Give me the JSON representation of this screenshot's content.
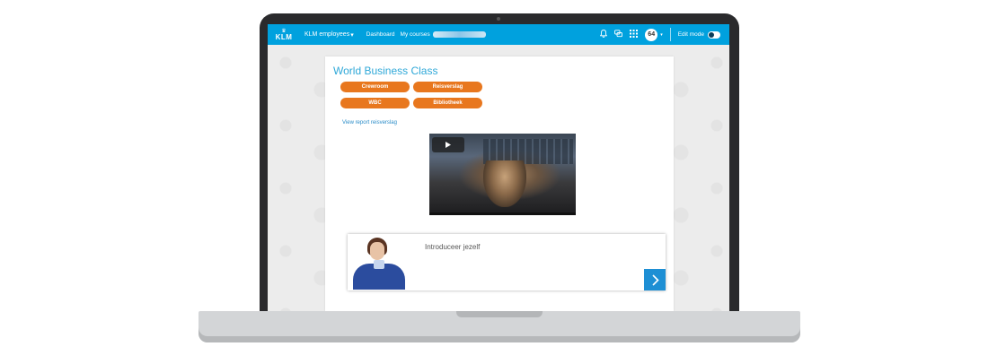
{
  "navbar": {
    "logo_text": "KLM",
    "brand": "KLM employees",
    "brand_caret": "▾",
    "links": [
      "Dashboard",
      "My courses"
    ],
    "avatar_text": "64",
    "edit_mode_label": "Edit mode",
    "edit_mode_on": false,
    "colors": {
      "bar": "#00a1de"
    }
  },
  "course": {
    "title": "World Business Class",
    "buttons": [
      "Crewroom",
      "Reisverslag",
      "WBC",
      "Bibliotheek"
    ],
    "report_link": "View report reisverslag",
    "button_color": "#e8771e"
  },
  "scenario": {
    "prompt": "Introduceer jezelf",
    "next_icon": "chevron-right-icon",
    "accent": "#1e8fd4"
  },
  "icons": [
    "bell-icon",
    "chat-icon",
    "apps-grid-icon",
    "play-icon",
    "chevron-right-icon"
  ]
}
